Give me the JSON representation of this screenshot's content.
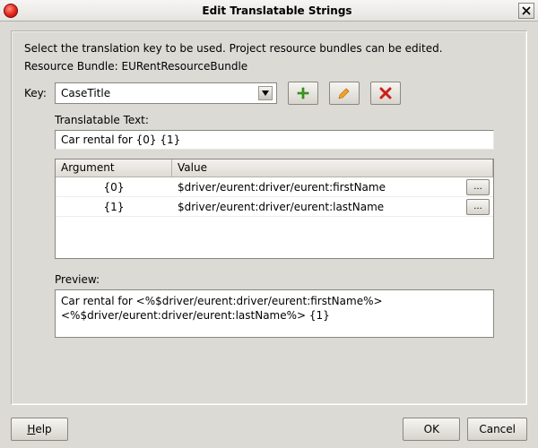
{
  "window": {
    "title": "Edit Translatable Strings"
  },
  "instruction": "Select the translation key to be used. Project resource bundles can be edited.",
  "resource_bundle": {
    "label": "Resource Bundle:",
    "value": "EURentResourceBundle"
  },
  "key_row": {
    "label": "Key:",
    "selected": "CaseTitle"
  },
  "icons": {
    "add": "add-icon",
    "edit": "edit-icon",
    "delete": "delete-icon"
  },
  "translatable": {
    "label": "Translatable Text:",
    "value": "Car rental for {0} {1}"
  },
  "args_table": {
    "headers": {
      "argument": "Argument",
      "value": "Value"
    },
    "rows": [
      {
        "argument": "{0}",
        "value": "$driver/eurent:driver/eurent:firstName",
        "btn": "..."
      },
      {
        "argument": "{1}",
        "value": "$driver/eurent:driver/eurent:lastName",
        "btn": "..."
      }
    ]
  },
  "preview": {
    "label": "Preview:",
    "value": "Car rental for <%$driver/eurent:driver/eurent:firstName%> <%$driver/eurent:driver/eurent:lastName%> {1}"
  },
  "buttons": {
    "help": "Help",
    "ok": "OK",
    "cancel": "Cancel"
  }
}
